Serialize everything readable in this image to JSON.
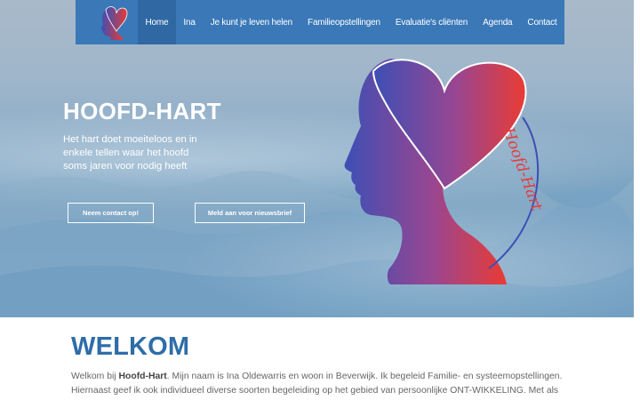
{
  "nav": {
    "logo_icon": "hoofd-hart-logo-icon",
    "items": [
      {
        "label": "Home",
        "active": true
      },
      {
        "label": "Ina",
        "active": false
      },
      {
        "label": "Je kunt je leven helen",
        "active": false
      },
      {
        "label": "Familieopstellingen",
        "active": false
      },
      {
        "label": "Evaluatie's cliënten",
        "active": false
      },
      {
        "label": "Agenda",
        "active": false
      },
      {
        "label": "Contact",
        "active": false
      }
    ]
  },
  "hero": {
    "title": "HOOFD-HART",
    "subtitle": "Het hart doet moeiteloos en in enkele tellen waar het hoofd soms jaren voor nodig heeft",
    "contact_button": "Neem contact op!",
    "newsletter_button": "Meld aan voor nieuwsbrief",
    "logo_text": "Hoofd-Hart",
    "logo_icon": "head-heart-illustration"
  },
  "welcome": {
    "title": "WELKOM",
    "text_prefix": "Welkom bij ",
    "text_brand": "Hoofd-Hart",
    "text_body": ". Mijn naam is Ina Oldewarris en woon in Beverwijk. Ik begeleid Familie- en systeemopstellingen. Hiernaast geef ik ook individueel diverse soorten begeleiding op het gebied van persoonlijke ONT-WIKKELING. Met als"
  },
  "colors": {
    "nav_bg": "#3a78b8",
    "nav_active": "#2f68a3",
    "accent": "#2e6da8",
    "logo_red": "#e63a3a",
    "logo_blue": "#3d4fb5"
  }
}
